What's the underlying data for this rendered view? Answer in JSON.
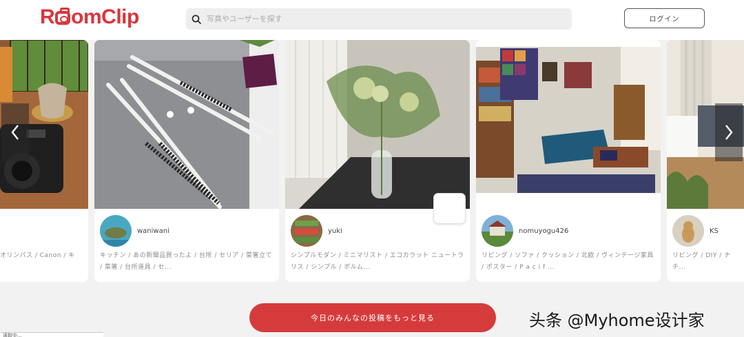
{
  "header": {
    "logo_text": "RoomClip",
    "search_placeholder": "写真やユーザーを探す",
    "login_label": "ログイン"
  },
  "cards": [
    {
      "username": "",
      "tags": "オリンパス / Canon / キ"
    },
    {
      "username": "waniwani",
      "tags": "キッチン / あの新聞品買ったよ / 台所 / セリア / 菜箸立て / 菜箸 / 台所道具 / セ..."
    },
    {
      "username": "yuki",
      "tags": "シンプルモダン / ミニマリスト / エコカラット ニュートラリス / シンプル / ボルム..."
    },
    {
      "username": "nomuyogu426",
      "tags": "リビング / ソファ / クッション / 北欧 / ヴィンテージ家具 / ポスター / P a c i f ..."
    },
    {
      "username": "KS",
      "tags": "リビング / DIY / ナチ..."
    }
  ],
  "more_button_label": "今日のみんなの投稿をもっと見る",
  "watermark": "头条 @Myhome设计家",
  "corner_text": "读取中...",
  "colors": {
    "brand": "#d9363e",
    "button": "#d63b3b"
  },
  "icons": {
    "search": "search-icon",
    "prev": "chevron-left-icon",
    "next": "chevron-right-icon"
  }
}
